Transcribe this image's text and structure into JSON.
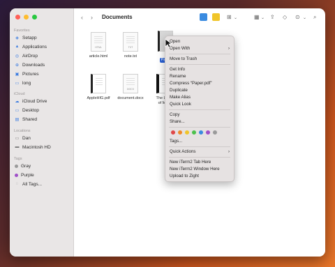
{
  "window": {
    "title": "Documents"
  },
  "sidebar": {
    "favorites_label": "Favorites",
    "favorites": [
      {
        "label": "Setapp",
        "icon": "setapp-icon"
      },
      {
        "label": "Applications",
        "icon": "applications-icon"
      },
      {
        "label": "AirDrop",
        "icon": "airdrop-icon"
      },
      {
        "label": "Downloads",
        "icon": "downloads-icon"
      },
      {
        "label": "Pictures",
        "icon": "pictures-icon"
      },
      {
        "label": "long",
        "icon": "folder-icon"
      }
    ],
    "icloud_label": "iCloud",
    "icloud": [
      {
        "label": "iCloud Drive",
        "icon": "icloud-icon"
      },
      {
        "label": "Desktop",
        "icon": "desktop-icon"
      },
      {
        "label": "Shared",
        "icon": "shared-folder-icon"
      }
    ],
    "locations_label": "Locations",
    "locations": [
      {
        "label": "Dan",
        "icon": "computer-icon"
      },
      {
        "label": "Macintosh HD",
        "icon": "disk-icon"
      }
    ],
    "tags_label": "Tags",
    "tags": [
      {
        "label": "Gray",
        "color": "#9a9a9a"
      },
      {
        "label": "Purple",
        "color": "#a050c8"
      },
      {
        "label": "All Tags...",
        "color": ""
      }
    ]
  },
  "files": [
    {
      "name": "article.html",
      "ext": "HTML"
    },
    {
      "name": "note.txt",
      "ext": "TXT"
    },
    {
      "name": "Pape",
      "ext": ""
    },
    {
      "name": "AppleHIG.pdf",
      "ext": ""
    },
    {
      "name": "document.docx",
      "ext": "DOCX"
    },
    {
      "name": "The Llam",
      "name2": "of Mod",
      "ext": ""
    }
  ],
  "context_menu": {
    "open": "Open",
    "open_with": "Open With",
    "move_to_trash": "Move to Trash",
    "get_info": "Get Info",
    "rename": "Rename",
    "compress": "Compress “Paper.pdf”",
    "duplicate": "Duplicate",
    "make_alias": "Make Alias",
    "quick_look": "Quick Look",
    "copy": "Copy",
    "share": "Share...",
    "tags": "Tags...",
    "quick_actions": "Quick Actions",
    "iterm_tab": "New iTerm2 Tab Here",
    "iterm_window": "New iTerm2 Window Here",
    "upload_zight": "Upload to Zight",
    "tag_colors": [
      "#e04848",
      "#f08a2a",
      "#f0c52a",
      "#4cc14c",
      "#3a8be0",
      "#a050c8",
      "#9a9a9a"
    ]
  },
  "colors": {
    "accent": "#2b63d8",
    "traffic_red": "#ff5f57",
    "traffic_yellow": "#febc2e",
    "traffic_green": "#28c840"
  }
}
